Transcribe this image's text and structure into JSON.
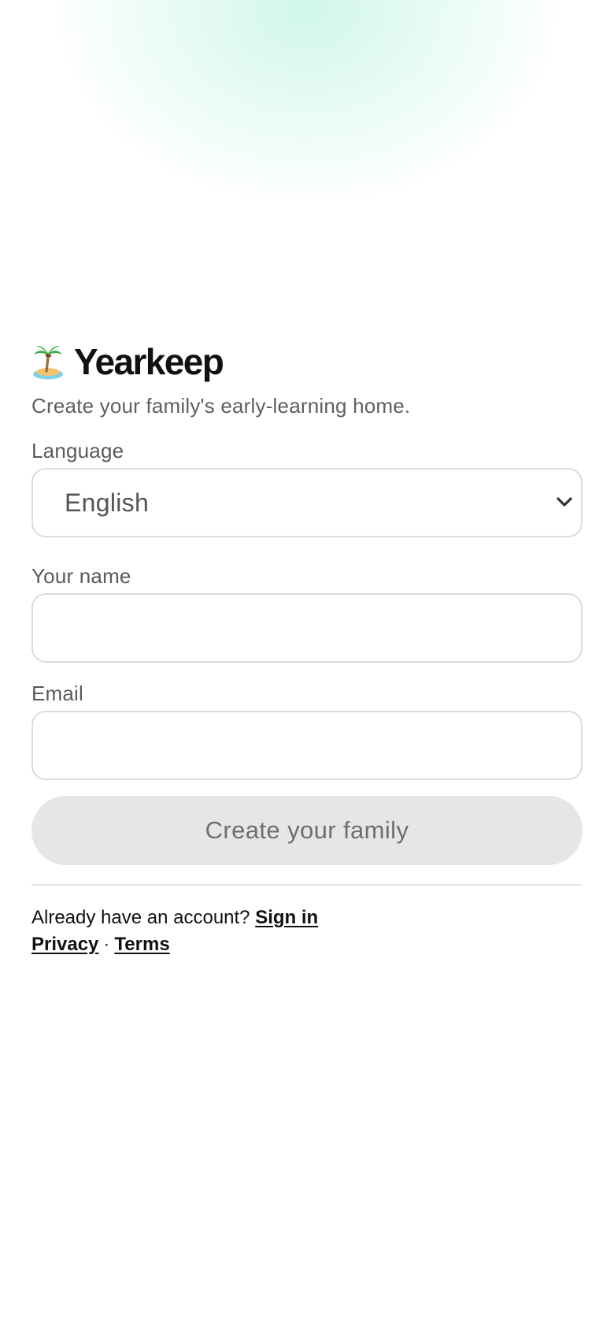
{
  "brand": {
    "icon": "desert-island-icon",
    "name": "Yearkeep"
  },
  "subtitle": "Create your family's early-learning home.",
  "form": {
    "language": {
      "label": "Language",
      "selected": "English"
    },
    "name": {
      "label": "Your name",
      "value": ""
    },
    "email": {
      "label": "Email",
      "value": ""
    },
    "submit_label": "Create your family"
  },
  "footer": {
    "account_prompt": "Already have an account?",
    "sign_in": "Sign in",
    "privacy": "Privacy",
    "separator": "·",
    "terms": "Terms"
  },
  "colors": {
    "glow": "#c8f5e6",
    "button_disabled_bg": "#e6e6e6",
    "button_disabled_text": "#6f6f6f",
    "border": "#dcdcdc"
  }
}
